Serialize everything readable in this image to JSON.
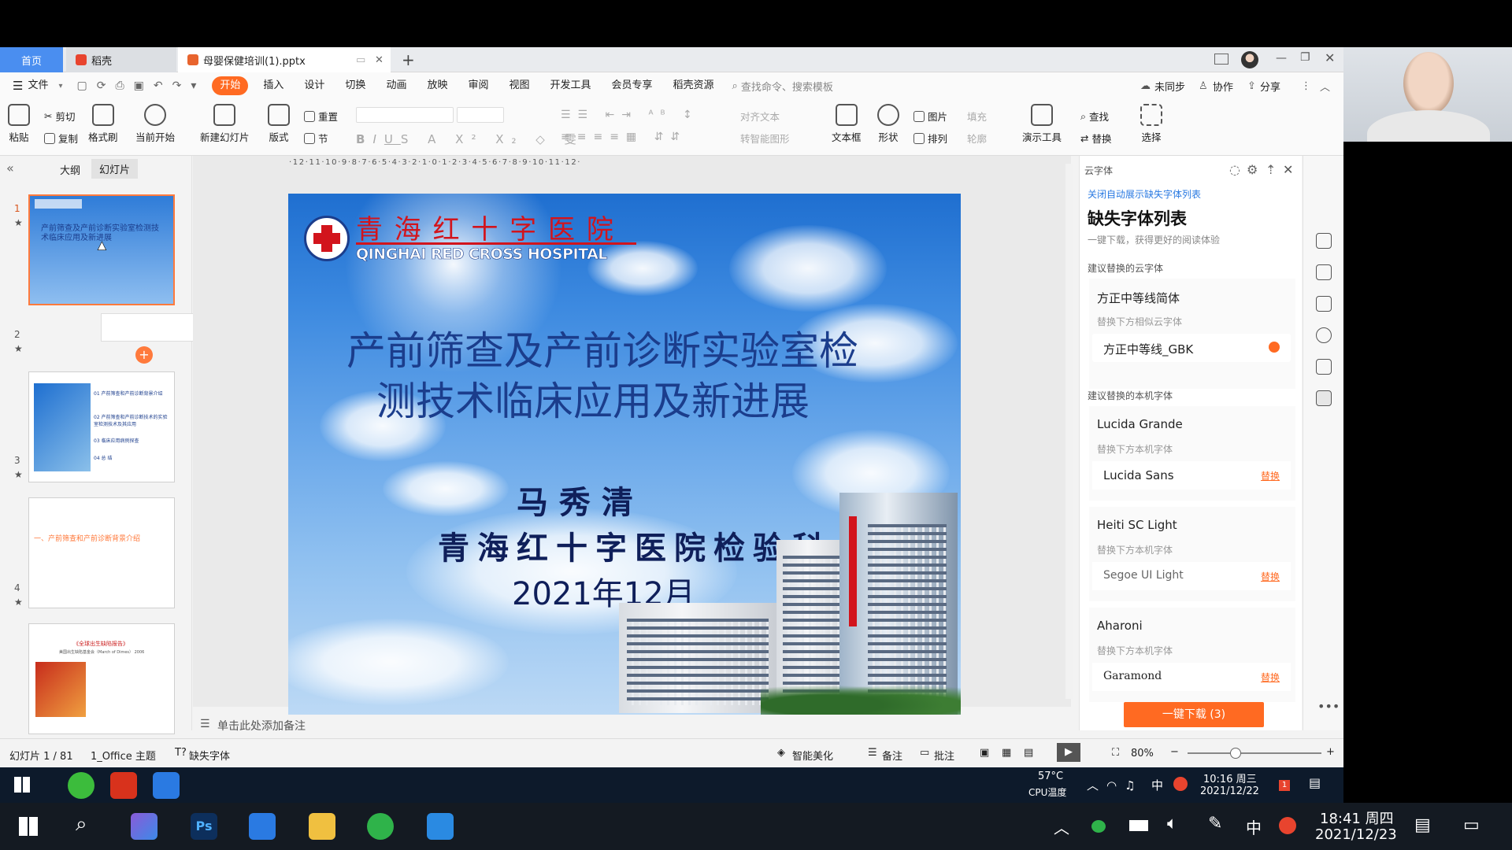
{
  "tabs": {
    "home": "首页",
    "docer": "稻壳",
    "doc": "母婴保健培训(1).pptx",
    "add": "+"
  },
  "menu": {
    "file": "文件",
    "items": [
      "开始",
      "插入",
      "设计",
      "切换",
      "动画",
      "放映",
      "审阅",
      "视图",
      "开发工具",
      "会员专享",
      "稻壳资源"
    ],
    "search": "查找命令、搜索模板",
    "sync": "未同步",
    "collab": "协作",
    "share": "分享"
  },
  "ribbon": {
    "paste": "粘贴",
    "cut": "剪切",
    "copy": "复制",
    "format_painter": "格式刷",
    "from_current": "当前开始",
    "new_slide": "新建幻灯片",
    "layout": "版式",
    "section": "节",
    "reset": "重置",
    "align_text": "对齐文本",
    "convert_smartart": "转智能图形",
    "textbox": "文本框",
    "shape": "形状",
    "picture": "图片",
    "arrange": "排列",
    "fill": "填充",
    "outline": "轮廓",
    "present_tool": "演示工具",
    "find": "查找",
    "replace": "替换",
    "select": "选择"
  },
  "leftpane": {
    "outline_tab": "大纲",
    "slides_tab": "幻灯片",
    "add": "+",
    "thumbs": [
      {
        "num": "1",
        "title": "产前筛查及产前诊断实验室检测技术临床应用及新进展"
      },
      {
        "num": "2",
        "items": [
          "01 产前筛查和产前诊断背景介绍",
          "02 产前筛查和产前诊断技术的实验室检测技术及其应用",
          "03 临床应用病例探查",
          "04 总 结"
        ]
      },
      {
        "num": "3",
        "title": "一、产前筛查和产前诊断背景介绍"
      },
      {
        "num": "4",
        "title": "《全球出生缺陷报告》",
        "subtitle": "美国出生缺陷基金会（March of Dimes） 2006"
      }
    ]
  },
  "ruler": "·12·11·10·9·8·7·6·5·4·3·2·1·0·1·2·3·4·5·6·7·8·9·10·11·12·",
  "slide": {
    "hospital_cn": "青 海 红 十 字 医 院",
    "hospital_en": "QINGHAI RED CROSS HOSPITAL",
    "title_line1": "产前筛查及产前诊断实验室检",
    "title_line2": "测技术临床应用及新进展",
    "author": "马 秀 清",
    "dept": "青海红十字医院检验科",
    "date": "2021年12月"
  },
  "notes": "单击此处添加备注",
  "fontpanel": {
    "header": "云字体",
    "close_auto": "关闭自动展示缺失字体列表",
    "title": "缺失字体列表",
    "subtitle": "一键下载，获得更好的阅读体验",
    "cloud_section": "建议替换的云字体",
    "local_section": "建议替换的本机字体",
    "fonts": [
      {
        "name": "方正中等线简体",
        "hint": "替换下方相似云字体",
        "replacement": "方正中等线_GBK",
        "action": ""
      },
      {
        "name": "Lucida Grande",
        "hint": "替换下方本机字体",
        "replacement": "Lucida Sans",
        "action": "替换"
      },
      {
        "name": "Heiti SC Light",
        "hint": "替换下方本机字体",
        "replacement": "Segoe UI Light",
        "action": "替换"
      },
      {
        "name": "Aharoni",
        "hint": "替换下方本机字体",
        "replacement": "Garamond",
        "action": "替换"
      }
    ],
    "download_btn": "一键下载 (3)"
  },
  "status": {
    "slide_count": "幻灯片 1 / 81",
    "theme": "1_Office 主题",
    "missing_font": "缺失字体",
    "beautify": "智能美化",
    "notes": "备注",
    "comment": "批注",
    "zoom": "80%"
  },
  "inner_taskbar": {
    "temp": "57°C",
    "temp_label": "CPU温度",
    "ime": "中",
    "time": "10:16 周三",
    "date": "2021/12/22",
    "notif_count": "1"
  },
  "outer_taskbar": {
    "ime": "中",
    "time": "18:41 周四",
    "date": "2021/12/23"
  },
  "colors": {
    "accent": "#ff6a22",
    "hospital_red": "#d2141c",
    "title_blue": "#1b3d8c",
    "link_blue": "#2a7ae2"
  }
}
